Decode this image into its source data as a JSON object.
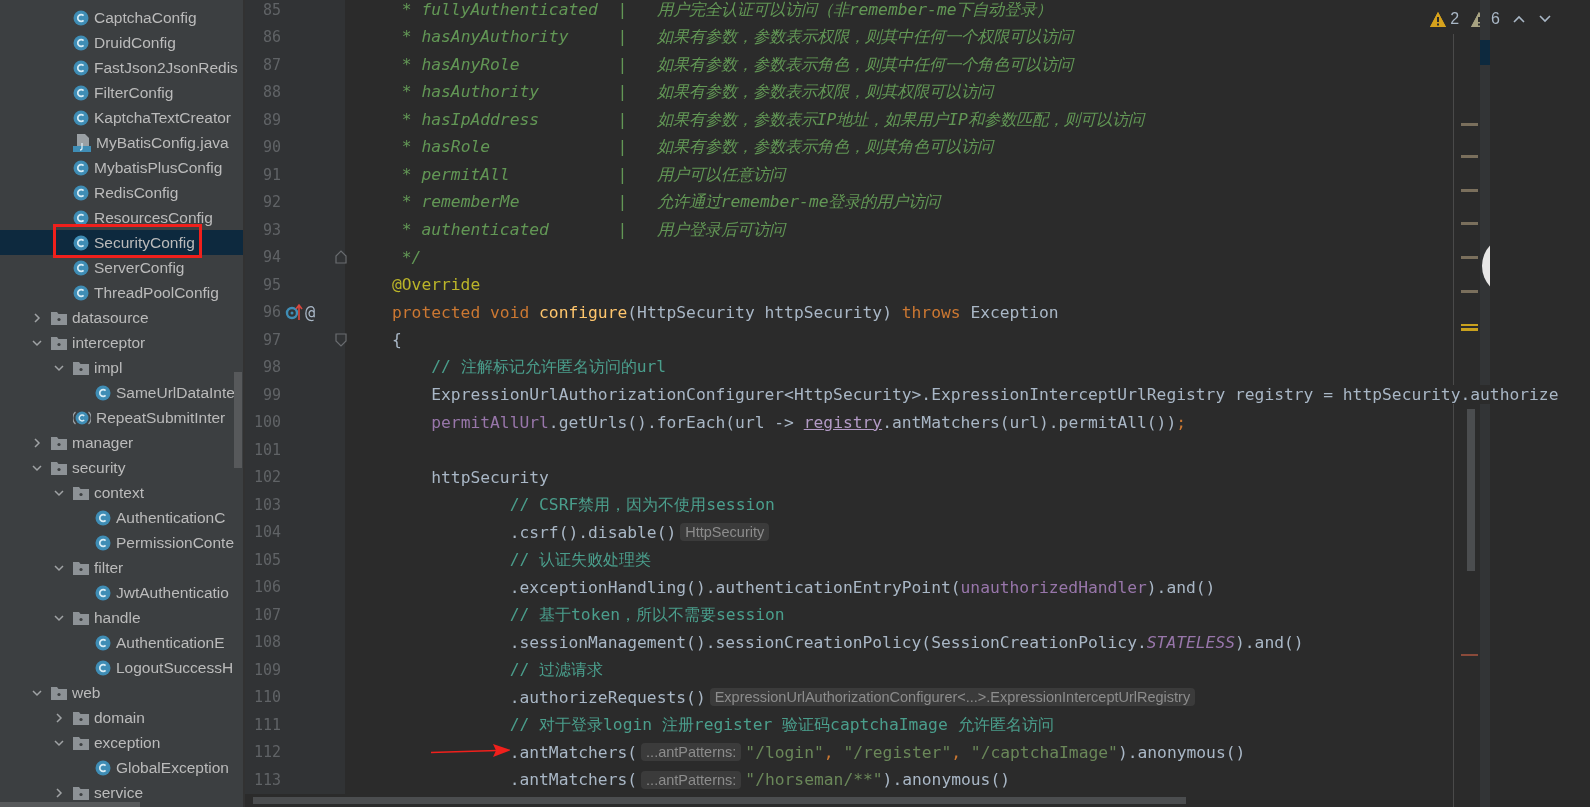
{
  "sidebar": {
    "tree": [
      {
        "kind": "continuation",
        "children": [
          {
            "name": "CaptchaConfig",
            "kind": "class",
            "selected": false
          },
          {
            "name": "DruidConfig",
            "kind": "class",
            "selected": false
          },
          {
            "name": "FastJson2JsonRedis",
            "kind": "class",
            "selected": false
          },
          {
            "name": "FilterConfig",
            "kind": "class",
            "selected": false
          },
          {
            "name": "KaptchaTextCreator",
            "kind": "class",
            "selected": false
          },
          {
            "name": "MyBatisConfig.java",
            "kind": "java-file",
            "selected": false
          },
          {
            "name": "MybatisPlusConfig",
            "kind": "class",
            "selected": false
          },
          {
            "name": "RedisConfig",
            "kind": "class",
            "selected": false
          },
          {
            "name": "ResourcesConfig",
            "kind": "class",
            "selected": false
          },
          {
            "name": "SecurityConfig",
            "kind": "class",
            "selected": true,
            "boxed": true
          },
          {
            "name": "ServerConfig",
            "kind": "class",
            "selected": false
          },
          {
            "name": "ThreadPoolConfig",
            "kind": "class",
            "selected": false
          }
        ]
      },
      {
        "name": "datasource",
        "kind": "folder",
        "expanded": false,
        "selected": false
      },
      {
        "name": "interceptor",
        "kind": "folder",
        "expanded": true,
        "selected": false,
        "children": [
          {
            "name": "impl",
            "kind": "folder",
            "expanded": true,
            "selected": false,
            "children": [
              {
                "name": "SameUrlDataInte",
                "kind": "class",
                "selected": false
              }
            ]
          },
          {
            "name": "RepeatSubmitInter",
            "kind": "abstract-class",
            "selected": false
          }
        ]
      },
      {
        "name": "manager",
        "kind": "folder",
        "expanded": false,
        "selected": false
      },
      {
        "name": "security",
        "kind": "folder",
        "expanded": true,
        "selected": false,
        "children": [
          {
            "name": "context",
            "kind": "folder",
            "expanded": true,
            "selected": false,
            "children": [
              {
                "name": "AuthenticationC",
                "kind": "class",
                "selected": false
              },
              {
                "name": "PermissionConte",
                "kind": "class",
                "selected": false
              }
            ]
          },
          {
            "name": "filter",
            "kind": "folder",
            "expanded": true,
            "selected": false,
            "children": [
              {
                "name": "JwtAuthenticatio",
                "kind": "class",
                "selected": false
              }
            ]
          },
          {
            "name": "handle",
            "kind": "folder",
            "expanded": true,
            "selected": false,
            "children": [
              {
                "name": "AuthenticationE",
                "kind": "class",
                "selected": false
              },
              {
                "name": "LogoutSuccessH",
                "kind": "class",
                "selected": false
              }
            ]
          }
        ]
      },
      {
        "name": "web",
        "kind": "folder",
        "expanded": true,
        "selected": false,
        "children": [
          {
            "name": "domain",
            "kind": "folder",
            "expanded": false,
            "selected": false
          },
          {
            "name": "exception",
            "kind": "folder",
            "expanded": true,
            "selected": false,
            "children": [
              {
                "name": "GlobalException",
                "kind": "class",
                "selected": false
              }
            ]
          },
          {
            "name": "service",
            "kind": "folder",
            "expanded": false,
            "selected": false
          }
        ]
      }
    ]
  },
  "editor": {
    "inspections": [
      {
        "kind": "warning",
        "count": "2"
      },
      {
        "kind": "weak-warning",
        "count": "6"
      }
    ],
    "lines": [
      {
        "number": "85",
        "tokens": [
          {
            "kind": "doc",
            "text": " * fullyAuthenticated  |   用户完全认证可以访问（非remember-me下自动登录）"
          }
        ]
      },
      {
        "number": "86",
        "tokens": [
          {
            "kind": "doc",
            "text": " * hasAnyAuthority     |   如果有参数，参数表示权限，则其中任何一个权限可以访问"
          }
        ]
      },
      {
        "number": "87",
        "tokens": [
          {
            "kind": "doc",
            "text": " * hasAnyRole          |   如果有参数，参数表示角色，则其中任何一个角色可以访问"
          }
        ]
      },
      {
        "number": "88",
        "tokens": [
          {
            "kind": "doc",
            "text": " * hasAuthority        |   如果有参数，参数表示权限，则其权限可以访问"
          }
        ]
      },
      {
        "number": "89",
        "tokens": [
          {
            "kind": "doc",
            "text": " * hasIpAddress        |   如果有参数，参数表示IP地址，如果用户IP和参数匹配，则可以访问"
          }
        ]
      },
      {
        "number": "90",
        "tokens": [
          {
            "kind": "doc",
            "text": " * hasRole             |   如果有参数，参数表示角色，则其角色可以访问"
          }
        ]
      },
      {
        "number": "91",
        "tokens": [
          {
            "kind": "doc",
            "text": " * permitAll           |   用户可以任意访问"
          }
        ]
      },
      {
        "number": "92",
        "tokens": [
          {
            "kind": "doc",
            "text": " * rememberMe          |   允许通过remember-me登录的用户访问"
          }
        ]
      },
      {
        "number": "93",
        "tokens": [
          {
            "kind": "doc",
            "text": " * authenticated       |   用户登录后可访问"
          }
        ]
      },
      {
        "number": "94",
        "kind": "fold-end",
        "tokens": [
          {
            "kind": "doc",
            "text": " */"
          }
        ]
      },
      {
        "number": "95",
        "tokens": [
          {
            "kind": "annotation",
            "text": "@Override"
          }
        ]
      },
      {
        "number": "96",
        "kind": "override",
        "gutter_text": "@",
        "tokens": [
          {
            "kind": "keyword",
            "text": "protected void "
          },
          {
            "kind": "method",
            "text": "configure"
          },
          {
            "kind": "plain",
            "text": "(HttpSecurity httpSecurity) "
          },
          {
            "kind": "keyword",
            "text": "throws"
          },
          {
            "kind": "plain",
            "text": " Exception"
          }
        ]
      },
      {
        "number": "97",
        "kind": "fold-start",
        "tokens": [
          {
            "kind": "plain",
            "text": "{"
          }
        ]
      },
      {
        "number": "98",
        "tokens": [
          {
            "kind": "comment",
            "text": "    // 注解标记允许匿名访问的url"
          }
        ]
      },
      {
        "number": "99",
        "tokens": [
          {
            "kind": "plain",
            "text": "    ExpressionUrlAuthorizationConfigurer<HttpSecurity>.ExpressionInterceptUrlRegistry registry = httpSecurity.authorize"
          }
        ]
      },
      {
        "number": "100",
        "tokens": [
          {
            "kind": "field",
            "text": "    permitAllUrl"
          },
          {
            "kind": "plain",
            "text": ".getUrls().forEach(url -> "
          },
          {
            "kind": "captured",
            "text": "registry"
          },
          {
            "kind": "plain",
            "text": ".antMatchers(url).permitAll())"
          },
          {
            "kind": "keyword",
            "text": ";"
          }
        ]
      },
      {
        "number": "101"
      },
      {
        "number": "102",
        "tokens": [
          {
            "kind": "plain",
            "text": "    httpSecurity"
          }
        ]
      },
      {
        "number": "103",
        "tokens": [
          {
            "kind": "comment",
            "text": "            // CSRF禁用，因为不使用session"
          }
        ]
      },
      {
        "number": "104",
        "tokens": [
          {
            "kind": "plain",
            "text": "            .csrf().disable()"
          },
          {
            "kind": "hint",
            "text": "HttpSecurity"
          }
        ]
      },
      {
        "number": "105",
        "tokens": [
          {
            "kind": "comment",
            "text": "            // 认证失败处理类"
          }
        ]
      },
      {
        "number": "106",
        "tokens": [
          {
            "kind": "plain",
            "text": "            .exceptionHandling().authenticationEntryPoint("
          },
          {
            "kind": "field",
            "text": "unauthorizedHandler"
          },
          {
            "kind": "plain",
            "text": ").and()"
          }
        ]
      },
      {
        "number": "107",
        "tokens": [
          {
            "kind": "comment",
            "text": "            // 基于token，所以不需要session"
          }
        ]
      },
      {
        "number": "108",
        "tokens": [
          {
            "kind": "plain",
            "text": "            .sessionManagement().sessionCreationPolicy(SessionCreationPolicy."
          },
          {
            "kind": "constant",
            "text": "STATELESS"
          },
          {
            "kind": "plain",
            "text": ").and()"
          }
        ]
      },
      {
        "number": "109",
        "tokens": [
          {
            "kind": "comment",
            "text": "            // 过滤请求"
          }
        ]
      },
      {
        "number": "110",
        "tokens": [
          {
            "kind": "plain",
            "text": "            .authorizeRequests()"
          },
          {
            "kind": "hint",
            "text": "ExpressionUrlAuthorizationConfigurer<...>.ExpressionInterceptUrlRegistry"
          }
        ]
      },
      {
        "number": "111",
        "tokens": [
          {
            "kind": "comment",
            "text": "            // 对于登录login 注册register 验证码captchaImage 允许匿名访问"
          }
        ]
      },
      {
        "number": "112",
        "arrow": true,
        "tokens": [
          {
            "kind": "plain",
            "text": "            .antMatchers("
          },
          {
            "kind": "hint",
            "text": "...antPatterns:"
          },
          {
            "kind": "string",
            "text": "\"/login\""
          },
          {
            "kind": "keyword",
            "text": ", "
          },
          {
            "kind": "string",
            "text": "\"/register\""
          },
          {
            "kind": "keyword",
            "text": ", "
          },
          {
            "kind": "string",
            "text": "\"/captchaImage\""
          },
          {
            "kind": "plain",
            "text": ").anonymous()"
          }
        ]
      },
      {
        "number": "113",
        "tokens": [
          {
            "kind": "plain",
            "text": "            .antMatchers("
          },
          {
            "kind": "hint",
            "text": "...antPatterns:"
          },
          {
            "kind": "string",
            "text": "\"/horseman/**\""
          },
          {
            "kind": "plain",
            "text": ").anonymous()"
          }
        ]
      }
    ]
  }
}
